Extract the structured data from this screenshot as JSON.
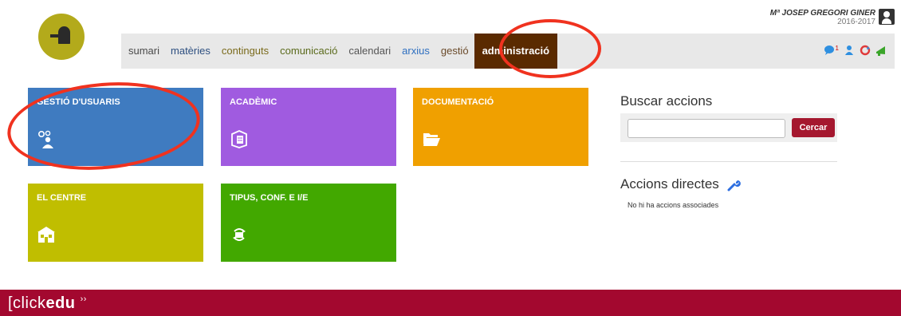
{
  "header": {
    "user_name": "Mª JOSEP GREGORI GINER",
    "year": "2016-2017",
    "icons": [
      "chat-icon",
      "user-icon",
      "refresh-icon",
      "announce-icon"
    ],
    "notification_count": "1"
  },
  "nav": {
    "items": [
      {
        "label": "sumari",
        "color": "#4a4a4a"
      },
      {
        "label": "matèries",
        "color": "#2d4f80"
      },
      {
        "label": "continguts",
        "color": "#7a6a1b"
      },
      {
        "label": "comunicació",
        "color": "#5a6a1b"
      },
      {
        "label": "calendari",
        "color": "#555555"
      },
      {
        "label": "arxius",
        "color": "#2e6fc0"
      },
      {
        "label": "gestió",
        "color": "#6a4a2a"
      }
    ],
    "active": {
      "label": "administració",
      "color": "#5a2a00"
    }
  },
  "tiles": [
    {
      "title": "GESTIÓ D'USUARIS",
      "color": "#3f7bc0",
      "icon": "users-settings-icon"
    },
    {
      "title": "ACADÈMIC",
      "color": "#a05be0",
      "icon": "book-icon"
    },
    {
      "title": "DOCUMENTACIÓ",
      "color": "#f0a000",
      "icon": "folder-icon"
    },
    {
      "title": "EL CENTRE",
      "color": "#c0be00",
      "icon": "school-icon"
    },
    {
      "title": "TIPUS, CONF. E I/E",
      "color": "#42a800",
      "icon": "sync-icon"
    }
  ],
  "search": {
    "title": "Buscar accions",
    "placeholder": "",
    "button": "Cercar"
  },
  "direct_actions": {
    "title": "Accions directes",
    "empty_text": "No hi ha accions associades"
  },
  "footer": {
    "brand_left": "[click",
    "brand_bold": "edu"
  }
}
